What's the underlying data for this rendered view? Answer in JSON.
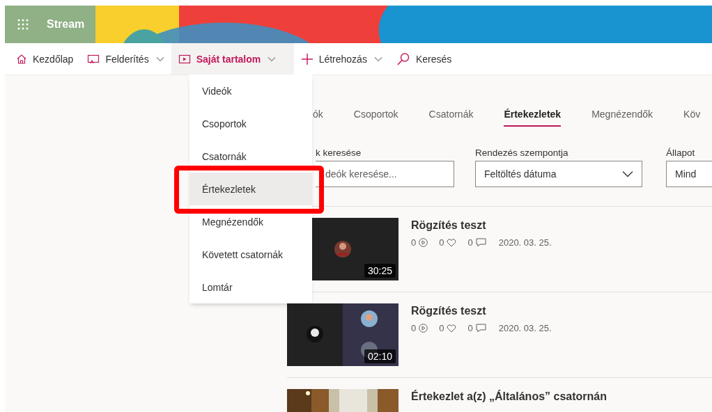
{
  "app": {
    "name": "Stream"
  },
  "nav": [
    {
      "kind": "home",
      "label": "Kezdőlap",
      "has_menu": false,
      "selected": false
    },
    {
      "kind": "discover",
      "label": "Felderítés",
      "has_menu": true,
      "selected": false
    },
    {
      "kind": "content",
      "label": "Saját tartalom",
      "has_menu": true,
      "selected": true
    },
    {
      "kind": "create",
      "label": "Létrehozás",
      "has_menu": true,
      "selected": false
    },
    {
      "kind": "search",
      "label": "Keresés",
      "has_menu": false,
      "selected": false
    }
  ],
  "menu": {
    "items": [
      {
        "label": "Videók",
        "selected": false,
        "highlighted": false
      },
      {
        "label": "Csoportok",
        "selected": false,
        "highlighted": false
      },
      {
        "label": "Csatornák",
        "selected": false,
        "highlighted": false
      },
      {
        "label": "Értekezletek",
        "selected": true,
        "highlighted": true
      },
      {
        "label": "Megnézendők",
        "selected": false,
        "highlighted": false
      },
      {
        "label": "Követett csatornák",
        "selected": false,
        "highlighted": false
      },
      {
        "label": "Lomtár",
        "selected": false,
        "highlighted": false
      }
    ]
  },
  "tabs": [
    {
      "label": "ók",
      "selected": false
    },
    {
      "label": "Csoportok",
      "selected": false
    },
    {
      "label": "Csatornák",
      "selected": false
    },
    {
      "label": "Értekezletek",
      "selected": true
    },
    {
      "label": "Megnézendők",
      "selected": false
    },
    {
      "label": "Köv",
      "selected": false
    }
  ],
  "filters": {
    "search": {
      "label": "k keresése",
      "placeholder": "deók keresése..."
    },
    "sort": {
      "label": "Rendezés szempontja",
      "value": "Feltöltés dátuma"
    },
    "status": {
      "label": "Állapot",
      "value": "Mind"
    }
  },
  "videos": [
    {
      "title": "Rögzítés teszt",
      "kind": "single",
      "duration": "30:25",
      "views": "0",
      "likes": "0",
      "comments": "0",
      "date": "2020. 03. 25."
    },
    {
      "title": "Rögzítés teszt",
      "kind": "split",
      "duration": "02:10",
      "views": "0",
      "likes": "0",
      "comments": "0",
      "date": "2020. 03. 25."
    },
    {
      "title": "Értekezlet a(z) „Általános” csatornán",
      "kind": "room"
    }
  ]
}
